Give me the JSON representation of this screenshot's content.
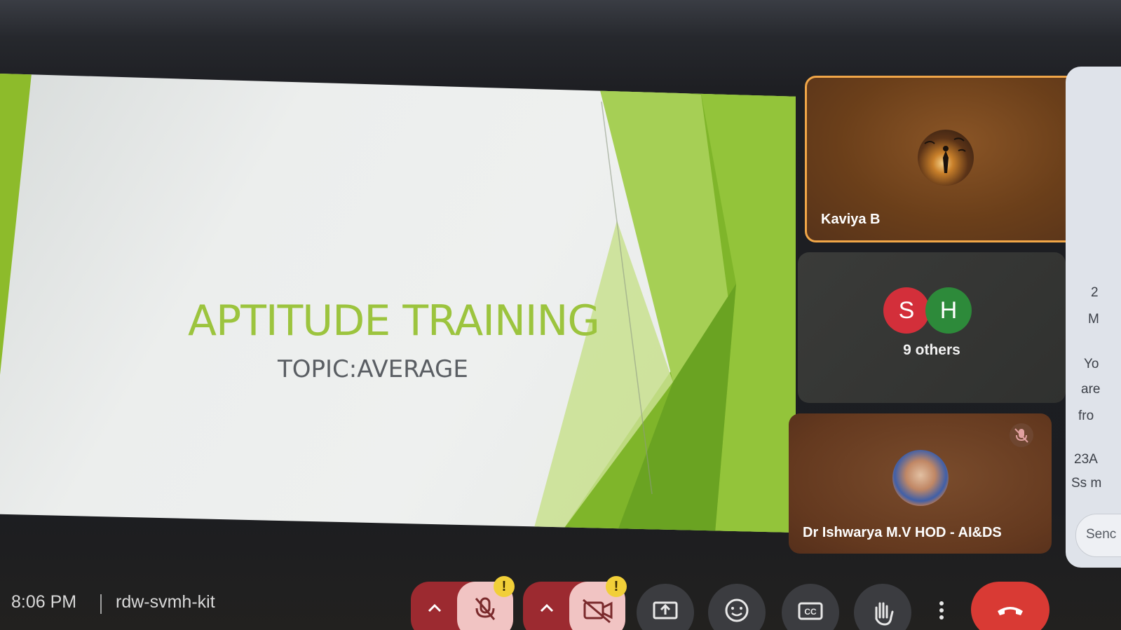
{
  "presentation": {
    "title": "APTITUDE TRAINING",
    "subtitle": "TOPIC:AVERAGE",
    "accent_color": "#9cc43e"
  },
  "participants": {
    "featured": {
      "name": "Kaviya B",
      "highlight_color": "#f0a648"
    },
    "others_group": {
      "initials": [
        "S",
        "H"
      ],
      "count_label": "9 others"
    },
    "host": {
      "name": "Dr Ishwarya M.V HOD - AI&DS",
      "muted": true
    }
  },
  "chat_panel": {
    "fragments": [
      "2",
      "M",
      "Yo",
      "are",
      "fro",
      "23A",
      "Ss m"
    ],
    "send_placeholder": "Senc"
  },
  "bottom_bar": {
    "time": "8:06 PM",
    "meeting_code": "rdw-svmh-kit",
    "controls": {
      "mic": {
        "state": "off",
        "warning": "!"
      },
      "camera": {
        "state": "off",
        "warning": "!"
      },
      "present": "present-screen-icon",
      "reactions": "emoji-icon",
      "captions": "closed-captions-icon",
      "raise_hand": "hand-icon",
      "more": "more-vertical-icon",
      "leave": "leave-call-icon"
    },
    "leave_color": "#d93a34"
  }
}
